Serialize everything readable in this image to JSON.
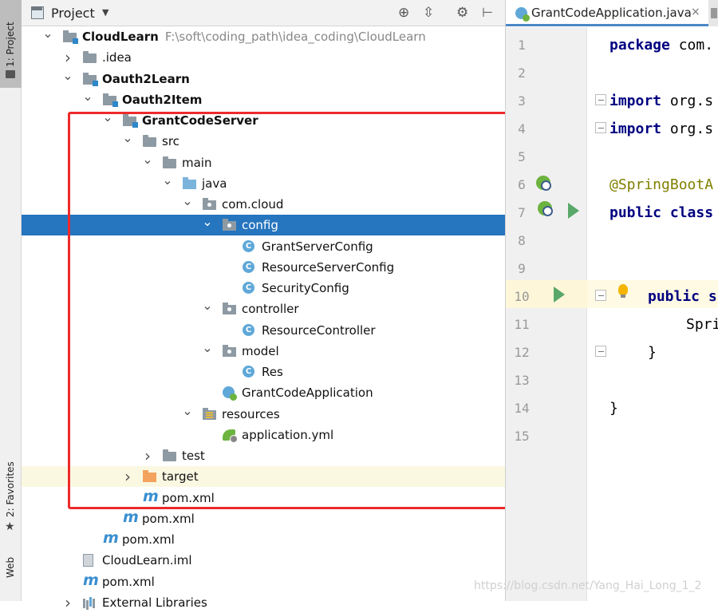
{
  "left_strip": {
    "project_tab": "1: Project",
    "favorites_tab": "2: Favorites",
    "web_tab": "Web"
  },
  "project_panel": {
    "title": "Project",
    "tree": [
      {
        "label": "CloudLearn",
        "path": "F:\\soft\\coding_path\\idea_coding\\CloudLearn",
        "bold": true,
        "icon": "module-folder-icon",
        "arrow": "down"
      },
      {
        "label": ".idea",
        "icon": "folder-icon",
        "arrow": "right"
      },
      {
        "label": "Oauth2Learn",
        "bold": true,
        "icon": "module-folder-icon",
        "arrow": "down"
      },
      {
        "label": "Oauth2Item",
        "bold": true,
        "icon": "module-folder-icon",
        "arrow": "down"
      },
      {
        "label": "GrantCodeServer",
        "bold": true,
        "icon": "module-folder-icon",
        "arrow": "down"
      },
      {
        "label": "src",
        "icon": "folder-icon",
        "arrow": "down"
      },
      {
        "label": "main",
        "icon": "folder-icon",
        "arrow": "down"
      },
      {
        "label": "java",
        "icon": "source-folder-icon",
        "arrow": "down"
      },
      {
        "label": "com.cloud",
        "icon": "package-icon",
        "arrow": "down"
      },
      {
        "label": "config",
        "icon": "package-icon",
        "arrow": "down",
        "selected": true
      },
      {
        "label": "GrantServerConfig",
        "icon": "class-icon"
      },
      {
        "label": "ResourceServerConfig",
        "icon": "class-icon"
      },
      {
        "label": "SecurityConfig",
        "icon": "class-icon"
      },
      {
        "label": "controller",
        "icon": "package-icon",
        "arrow": "down"
      },
      {
        "label": "ResourceController",
        "icon": "class-icon"
      },
      {
        "label": "model",
        "icon": "package-icon",
        "arrow": "down"
      },
      {
        "label": "Res",
        "icon": "class-icon"
      },
      {
        "label": "GrantCodeApplication",
        "icon": "spring-boot-app-icon"
      },
      {
        "label": "resources",
        "icon": "resources-folder-icon",
        "arrow": "down"
      },
      {
        "label": "application.yml",
        "icon": "spring-yml-icon"
      },
      {
        "label": "test",
        "icon": "folder-icon",
        "arrow": "right"
      },
      {
        "label": "target",
        "icon": "excluded-folder-icon",
        "arrow": "right",
        "highlighted": true
      },
      {
        "label": "pom.xml",
        "icon": "maven-icon"
      },
      {
        "label": "pom.xml",
        "icon": "maven-icon"
      },
      {
        "label": "pom.xml",
        "icon": "maven-icon"
      },
      {
        "label": "CloudLearn.iml",
        "icon": "iml-file-icon"
      },
      {
        "label": "pom.xml",
        "icon": "maven-icon"
      },
      {
        "label": "External Libraries",
        "icon": "library-icon",
        "arrow": "right"
      }
    ]
  },
  "editor": {
    "tab_label": "GrantCodeApplication.java",
    "close_glyph": "×",
    "line_numbers": [
      "1",
      "2",
      "3",
      "4",
      "5",
      "6",
      "7",
      "8",
      "9",
      "10",
      "11",
      "12",
      "13",
      "14",
      "15"
    ],
    "code": {
      "l1_kw": "package",
      "l1_rest": " com.",
      "l3_kw": "import",
      "l3_rest": " org.s",
      "l4_kw": "import",
      "l4_rest": " org.s",
      "l6_ann": "@SpringBootA",
      "l7_kw": "public class",
      "l10_kw": "public s",
      "l11_text": "Spri",
      "l12_text": "}",
      "l14_text": "}"
    }
  },
  "watermark": "https://blog.csdn.net/Yang_Hai_Long_1_2"
}
